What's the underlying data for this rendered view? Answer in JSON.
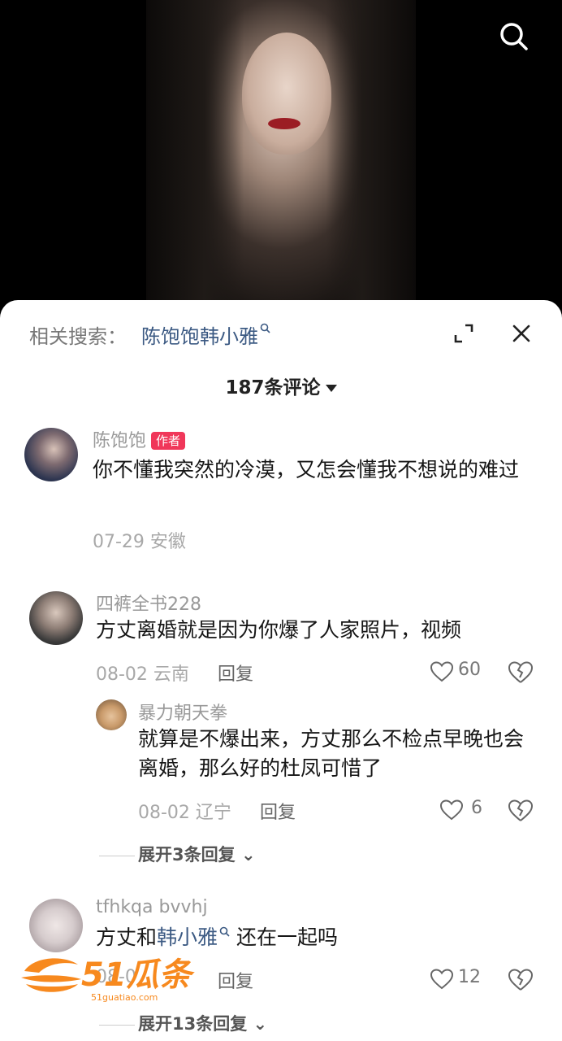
{
  "colors": {
    "accent_link": "#3c5a83",
    "author_badge": "#f0375a",
    "watermark": "#f7891e"
  },
  "video": {
    "icon": "search-icon"
  },
  "sheet": {
    "related_label": "相关搜索：",
    "related_query": "陈饱饱韩小雅",
    "comment_count": "187条评论",
    "icons": [
      "expand-icon",
      "close-icon",
      "caret-down-icon"
    ]
  },
  "comments": [
    {
      "username": "陈饱饱",
      "badge": "作者",
      "text": "你不懂我突然的冷漠，又怎会懂我不想说的难过",
      "meta": "07-29 安徽"
    },
    {
      "username": "四裤全书228",
      "text": "方丈离婚就是因为你爆了人家照片，视频",
      "meta": "08-02 云南",
      "reply_label": "回复",
      "likes": "60",
      "reply": {
        "username": "暴力朝天拳",
        "text": "就算是不爆出来，方丈那么不检点早晚也会离婚，那么好的杜凤可惜了",
        "meta": "08-02 辽宁",
        "reply_label": "回复",
        "likes": "6"
      },
      "expand_label": "展开3条回复"
    },
    {
      "username": "tfhkqa bvvhj",
      "text_before": "方丈和",
      "text_link": "韩小雅",
      "text_after": " 还在一起吗",
      "meta": "08-0",
      "reply_label": "回复",
      "likes": "12",
      "expand_label": "展开13条回复"
    }
  ],
  "watermark": {
    "brand": "51瓜条",
    "domain": "51guatiao.com"
  }
}
